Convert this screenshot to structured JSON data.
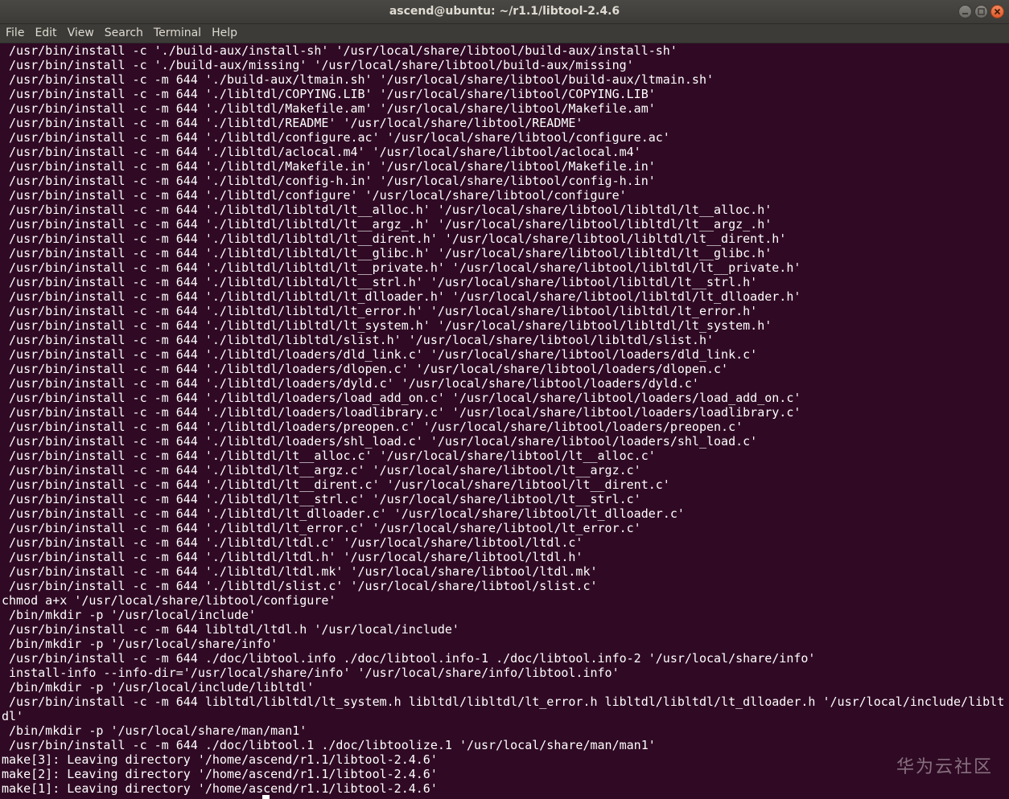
{
  "window": {
    "title": "ascend@ubuntu: ~/r1.1/libtool-2.4.6"
  },
  "menu": [
    "File",
    "Edit",
    "View",
    "Search",
    "Terminal",
    "Help"
  ],
  "terminal": {
    "lines": [
      " /usr/bin/install -c './build-aux/install-sh' '/usr/local/share/libtool/build-aux/install-sh'",
      " /usr/bin/install -c './build-aux/missing' '/usr/local/share/libtool/build-aux/missing'",
      " /usr/bin/install -c -m 644 './build-aux/ltmain.sh' '/usr/local/share/libtool/build-aux/ltmain.sh'",
      " /usr/bin/install -c -m 644 './libltdl/COPYING.LIB' '/usr/local/share/libtool/COPYING.LIB'",
      " /usr/bin/install -c -m 644 './libltdl/Makefile.am' '/usr/local/share/libtool/Makefile.am'",
      " /usr/bin/install -c -m 644 './libltdl/README' '/usr/local/share/libtool/README'",
      " /usr/bin/install -c -m 644 './libltdl/configure.ac' '/usr/local/share/libtool/configure.ac'",
      " /usr/bin/install -c -m 644 './libltdl/aclocal.m4' '/usr/local/share/libtool/aclocal.m4'",
      " /usr/bin/install -c -m 644 './libltdl/Makefile.in' '/usr/local/share/libtool/Makefile.in'",
      " /usr/bin/install -c -m 644 './libltdl/config-h.in' '/usr/local/share/libtool/config-h.in'",
      " /usr/bin/install -c -m 644 './libltdl/configure' '/usr/local/share/libtool/configure'",
      " /usr/bin/install -c -m 644 './libltdl/libltdl/lt__alloc.h' '/usr/local/share/libtool/libltdl/lt__alloc.h'",
      " /usr/bin/install -c -m 644 './libltdl/libltdl/lt__argz_.h' '/usr/local/share/libtool/libltdl/lt__argz_.h'",
      " /usr/bin/install -c -m 644 './libltdl/libltdl/lt__dirent.h' '/usr/local/share/libtool/libltdl/lt__dirent.h'",
      " /usr/bin/install -c -m 644 './libltdl/libltdl/lt__glibc.h' '/usr/local/share/libtool/libltdl/lt__glibc.h'",
      " /usr/bin/install -c -m 644 './libltdl/libltdl/lt__private.h' '/usr/local/share/libtool/libltdl/lt__private.h'",
      " /usr/bin/install -c -m 644 './libltdl/libltdl/lt__strl.h' '/usr/local/share/libtool/libltdl/lt__strl.h'",
      " /usr/bin/install -c -m 644 './libltdl/libltdl/lt_dlloader.h' '/usr/local/share/libtool/libltdl/lt_dlloader.h'",
      " /usr/bin/install -c -m 644 './libltdl/libltdl/lt_error.h' '/usr/local/share/libtool/libltdl/lt_error.h'",
      " /usr/bin/install -c -m 644 './libltdl/libltdl/lt_system.h' '/usr/local/share/libtool/libltdl/lt_system.h'",
      " /usr/bin/install -c -m 644 './libltdl/libltdl/slist.h' '/usr/local/share/libtool/libltdl/slist.h'",
      " /usr/bin/install -c -m 644 './libltdl/loaders/dld_link.c' '/usr/local/share/libtool/loaders/dld_link.c'",
      " /usr/bin/install -c -m 644 './libltdl/loaders/dlopen.c' '/usr/local/share/libtool/loaders/dlopen.c'",
      " /usr/bin/install -c -m 644 './libltdl/loaders/dyld.c' '/usr/local/share/libtool/loaders/dyld.c'",
      " /usr/bin/install -c -m 644 './libltdl/loaders/load_add_on.c' '/usr/local/share/libtool/loaders/load_add_on.c'",
      " /usr/bin/install -c -m 644 './libltdl/loaders/loadlibrary.c' '/usr/local/share/libtool/loaders/loadlibrary.c'",
      " /usr/bin/install -c -m 644 './libltdl/loaders/preopen.c' '/usr/local/share/libtool/loaders/preopen.c'",
      " /usr/bin/install -c -m 644 './libltdl/loaders/shl_load.c' '/usr/local/share/libtool/loaders/shl_load.c'",
      " /usr/bin/install -c -m 644 './libltdl/lt__alloc.c' '/usr/local/share/libtool/lt__alloc.c'",
      " /usr/bin/install -c -m 644 './libltdl/lt__argz.c' '/usr/local/share/libtool/lt__argz.c'",
      " /usr/bin/install -c -m 644 './libltdl/lt__dirent.c' '/usr/local/share/libtool/lt__dirent.c'",
      " /usr/bin/install -c -m 644 './libltdl/lt__strl.c' '/usr/local/share/libtool/lt__strl.c'",
      " /usr/bin/install -c -m 644 './libltdl/lt_dlloader.c' '/usr/local/share/libtool/lt_dlloader.c'",
      " /usr/bin/install -c -m 644 './libltdl/lt_error.c' '/usr/local/share/libtool/lt_error.c'",
      " /usr/bin/install -c -m 644 './libltdl/ltdl.c' '/usr/local/share/libtool/ltdl.c'",
      " /usr/bin/install -c -m 644 './libltdl/ltdl.h' '/usr/local/share/libtool/ltdl.h'",
      " /usr/bin/install -c -m 644 './libltdl/ltdl.mk' '/usr/local/share/libtool/ltdl.mk'",
      " /usr/bin/install -c -m 644 './libltdl/slist.c' '/usr/local/share/libtool/slist.c'",
      "chmod a+x '/usr/local/share/libtool/configure'",
      " /bin/mkdir -p '/usr/local/include'",
      " /usr/bin/install -c -m 644 libltdl/ltdl.h '/usr/local/include'",
      " /bin/mkdir -p '/usr/local/share/info'",
      " /usr/bin/install -c -m 644 ./doc/libtool.info ./doc/libtool.info-1 ./doc/libtool.info-2 '/usr/local/share/info'",
      " install-info --info-dir='/usr/local/share/info' '/usr/local/share/info/libtool.info'",
      " /bin/mkdir -p '/usr/local/include/libltdl'",
      " /usr/bin/install -c -m 644 libltdl/libltdl/lt_system.h libltdl/libltdl/lt_error.h libltdl/libltdl/lt_dlloader.h '/usr/local/include/liblt",
      "dl'",
      " /bin/mkdir -p '/usr/local/share/man/man1'",
      " /usr/bin/install -c -m 644 ./doc/libtool.1 ./doc/libtoolize.1 '/usr/local/share/man/man1'",
      "make[3]: Leaving directory '/home/ascend/r1.1/libtool-2.4.6'",
      "make[2]: Leaving directory '/home/ascend/r1.1/libtool-2.4.6'",
      "make[1]: Leaving directory '/home/ascend/r1.1/libtool-2.4.6'"
    ]
  },
  "watermark": "华为云社区",
  "icons": {
    "minimize": "minimize-icon",
    "maximize": "maximize-icon",
    "close": "close-icon"
  },
  "colors": {
    "terminal_bg": "#300a24",
    "terminal_fg": "#ffffff",
    "titlebar_bg": "#3c3b37",
    "close_button": "#e05a2b"
  }
}
